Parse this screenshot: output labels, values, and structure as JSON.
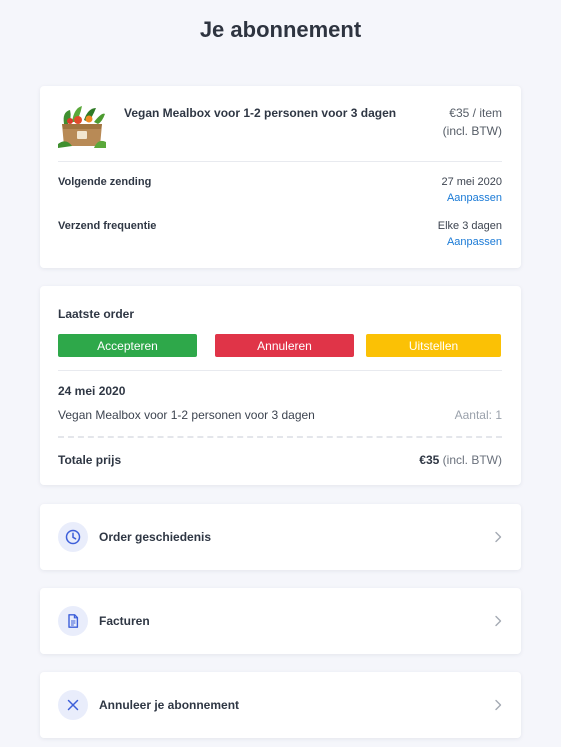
{
  "page": {
    "title": "Je abonnement"
  },
  "subscription": {
    "product_name": "Vegan Mealbox voor 1-2 personen voor 3 dagen",
    "price": "€35 / item",
    "vat_note": "(incl. BTW)",
    "next_shipment": {
      "label": "Volgende zending",
      "value": "27 mei 2020",
      "action": "Aanpassen"
    },
    "frequency": {
      "label": "Verzend frequentie",
      "value": "Elke 3 dagen",
      "action": "Aanpassen"
    }
  },
  "last_order": {
    "title": "Laatste order",
    "buttons": {
      "accept": "Accepteren",
      "cancel": "Annuleren",
      "postpone": "Uitstellen"
    },
    "date": "24 mei 2020",
    "item_name": "Vegan Mealbox voor 1-2 personen voor 3 dagen",
    "quantity": "Aantal: 1",
    "total_label": "Totale prijs",
    "total_amount": "€35",
    "total_vat": " (incl. BTW)"
  },
  "nav": [
    {
      "label": "Order geschiedenis",
      "icon": "clock-icon"
    },
    {
      "label": "Facturen",
      "icon": "document-icon"
    },
    {
      "label": "Annuleer je abonnement",
      "icon": "close-icon"
    }
  ],
  "colors": {
    "accept": "#2ea84a",
    "cancel": "#e03448",
    "postpone": "#fbc105",
    "link": "#1a7ad6",
    "icon": "#3d5fd9",
    "icon_bg": "#e9edfb"
  }
}
